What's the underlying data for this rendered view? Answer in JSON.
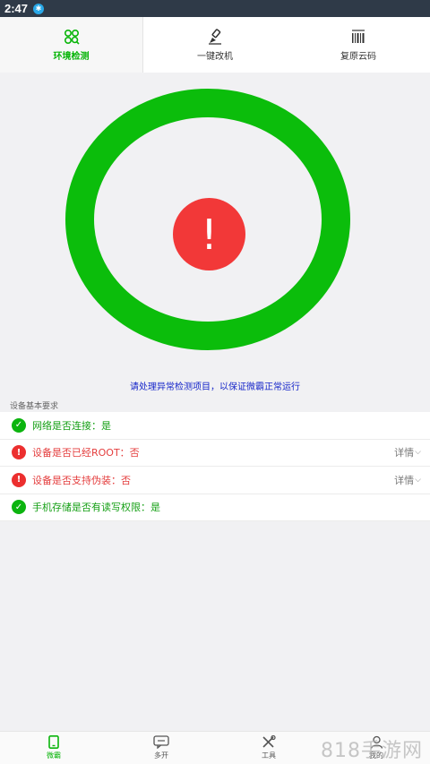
{
  "status_bar": {
    "time": "2:47",
    "bluetooth_icon": "bluetooth-icon"
  },
  "top_tabs": [
    {
      "label": "环境检测",
      "icon": "detect-icon",
      "active": true
    },
    {
      "label": "一键改机",
      "icon": "brush-icon",
      "active": false
    },
    {
      "label": "复原云码",
      "icon": "barcode-icon",
      "active": false
    }
  ],
  "ring": {
    "color": "#0bbd0b",
    "alert_symbol": "!",
    "alert_color": "#f23838"
  },
  "notice": "请处理异常检测项目，以保证微霸正常运行",
  "section_title": "设备基本要求",
  "checks": [
    {
      "text": "网络是否连接：是",
      "status": "ok",
      "icon_symbol": "✓"
    },
    {
      "text": "设备是否已经ROOT：否",
      "status": "bad",
      "icon_symbol": "!",
      "detail": "详情",
      "chevron": "⌵"
    },
    {
      "text": "设备是否支持伪装：否",
      "status": "bad",
      "icon_symbol": "!",
      "detail": "详情",
      "chevron": "⌵"
    },
    {
      "text": "手机存储是否有读写权限：是",
      "status": "ok",
      "icon_symbol": "✓"
    }
  ],
  "bottom_nav": [
    {
      "label": "微霸",
      "icon": "phone-icon",
      "active": true
    },
    {
      "label": "多开",
      "icon": "chat-icon",
      "active": false
    },
    {
      "label": "工具",
      "icon": "tools-icon",
      "active": false
    },
    {
      "label": "我的",
      "icon": "user-icon",
      "active": false
    }
  ],
  "watermark": "818手游网",
  "colors": {
    "green": "#09b50a",
    "red": "#e43d3d",
    "blue_text": "#1525c9"
  }
}
